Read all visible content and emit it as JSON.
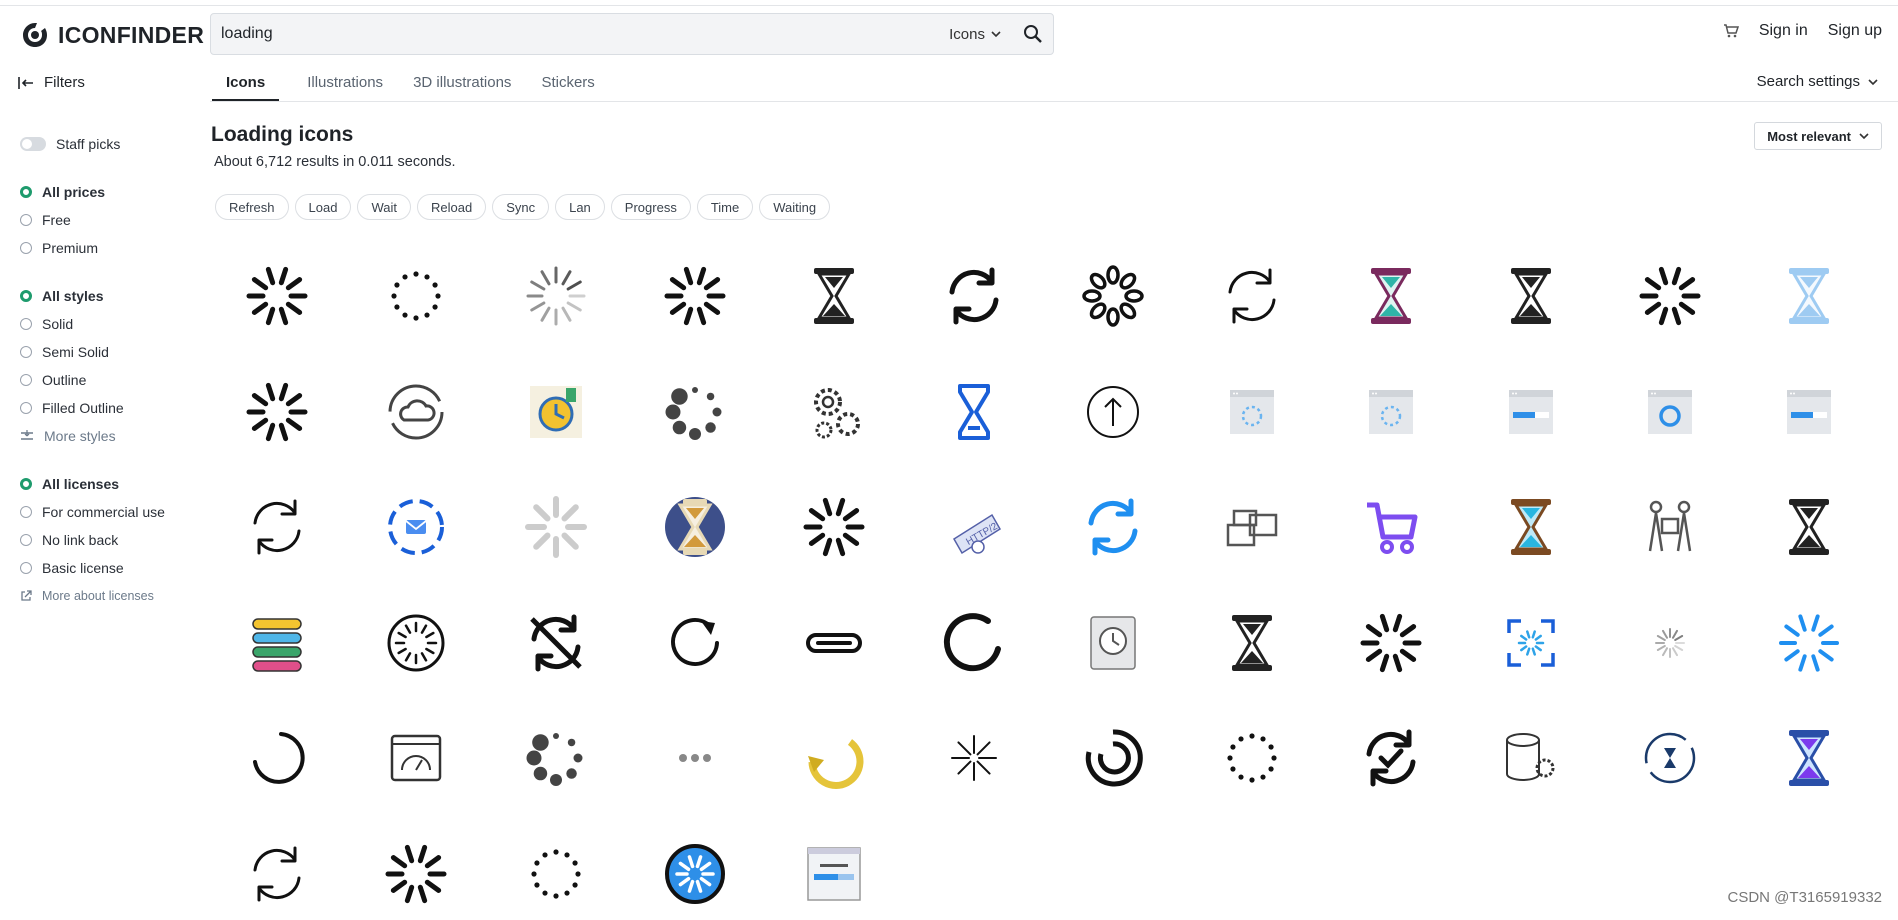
{
  "header": {
    "logo_text": "ICONFINDER",
    "search_value": "loading",
    "search_type": "Icons",
    "sign_in": "Sign in",
    "sign_up": "Sign up"
  },
  "nav": {
    "filters_label": "Filters",
    "tabs": [
      {
        "label": "Icons",
        "active": true
      },
      {
        "label": "Illustrations",
        "active": false
      },
      {
        "label": "3D illustrations",
        "active": false
      },
      {
        "label": "Stickers",
        "active": false
      }
    ],
    "search_settings": "Search settings"
  },
  "sidebar": {
    "staff_picks": "Staff picks",
    "prices": [
      "All prices",
      "Free",
      "Premium"
    ],
    "styles": [
      "All styles",
      "Solid",
      "Semi Solid",
      "Outline",
      "Filled Outline"
    ],
    "more_styles": "More styles",
    "licenses": [
      "All licenses",
      "For commercial use",
      "No link back",
      "Basic license"
    ],
    "more_licenses": "More about licenses"
  },
  "results": {
    "title": "Loading icons",
    "count_text": "About 6,712 results in 0.011 seconds.",
    "sort": "Most relevant",
    "chips": [
      "Refresh",
      "Load",
      "Wait",
      "Reload",
      "Sync",
      "Lan",
      "Progress",
      "Time",
      "Waiting"
    ]
  },
  "icons": [
    "spinner-icon",
    "dotted-circle-icon",
    "spinner-gray-icon",
    "spinner-icon",
    "hourglass-icon",
    "refresh-icon",
    "flower-loader-icon",
    "sync-icon",
    "hourglass-colored-icon",
    "hourglass-icon",
    "spinner-icon",
    "hourglass-light-icon",
    "spinner-icon",
    "cloud-sync-icon",
    "productivity-gear-icon",
    "dots-loader-icon",
    "gears-icon",
    "hourglass-blue-icon",
    "upload-circle-icon",
    "browser-loading-icon",
    "browser-loading-icon",
    "browser-progress-icon",
    "browser-circle-icon",
    "browser-progress-icon",
    "sync-icon",
    "mail-loading-icon",
    "spinner-light-icon",
    "hourglass-badge-icon",
    "spinner-icon",
    "http2-icon",
    "refresh-blue-icon",
    "boxes-icon",
    "cart-icon",
    "hourglass-teal-icon",
    "delivery-people-icon",
    "hourglass-icon",
    "layers-stack-icon",
    "clock-loader-icon",
    "sync-off-icon",
    "reload-icon",
    "progress-bar-icon",
    "circle-progress-icon",
    "clock-app-icon",
    "hourglass-icon",
    "spinner-icon",
    "scan-loading-icon",
    "spinner-small-icon",
    "spinner-blue-icon",
    "arc-loader-icon",
    "dashboard-icon",
    "dots-loader-icon",
    "ellipsis-icon",
    "refresh-yellow-icon",
    "burst-icon",
    "ring-loader-icon",
    "dotted-circle-icon",
    "sync-check-icon",
    "database-gear-icon",
    "time-sync-icon",
    "hourglass-gradient-icon",
    "sync-icon",
    "spinner-icon",
    "dotted-circle-icon",
    "spinner-badge-icon",
    "browser-window-icon"
  ],
  "colors": {
    "accent_green": "#1e9b6d",
    "blue": "#1a5fd8",
    "light_blue": "#1f8ff0",
    "purple": "#7c3aed"
  },
  "watermark": "CSDN @T3165919332"
}
